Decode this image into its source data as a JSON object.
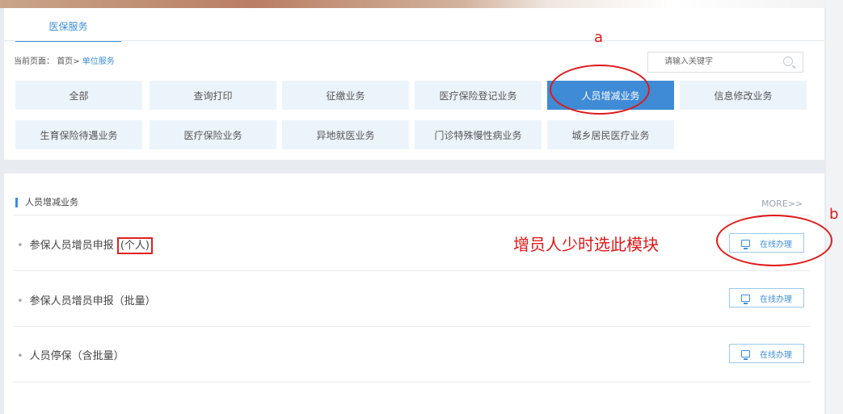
{
  "tab": {
    "label": "医保服务"
  },
  "breadcrumb": {
    "prefix": "当前页面：",
    "home": "首页>",
    "current": "单位服务"
  },
  "search": {
    "placeholder": "请输入关键字"
  },
  "categories": [
    {
      "label": "全部",
      "active": false
    },
    {
      "label": "查询打印",
      "active": false
    },
    {
      "label": "征缴业务",
      "active": false
    },
    {
      "label": "医疗保险登记业务",
      "active": false
    },
    {
      "label": "人员增减业务",
      "active": true
    },
    {
      "label": "信息修改业务",
      "active": false
    },
    {
      "label": "生育保险待遇业务",
      "active": false
    },
    {
      "label": "医疗保险业务",
      "active": false
    },
    {
      "label": "异地就医业务",
      "active": false
    },
    {
      "label": "门诊特殊慢性病业务",
      "active": false
    },
    {
      "label": "城乡居民医疗业务",
      "active": false
    }
  ],
  "section": {
    "title": "人员增减业务",
    "more": "MORE>>"
  },
  "items": [
    {
      "label": "参保人员增员申报",
      "suffix": "(个人)",
      "action": "在线办理"
    },
    {
      "label": "参保人员增员申报（批量）",
      "action": "在线办理"
    },
    {
      "label": "人员停保（含批量）",
      "action": "在线办理"
    }
  ],
  "annotations": {
    "a": "a",
    "b": "b",
    "note": "增员人少时选此模块",
    "color": "#e01818"
  }
}
